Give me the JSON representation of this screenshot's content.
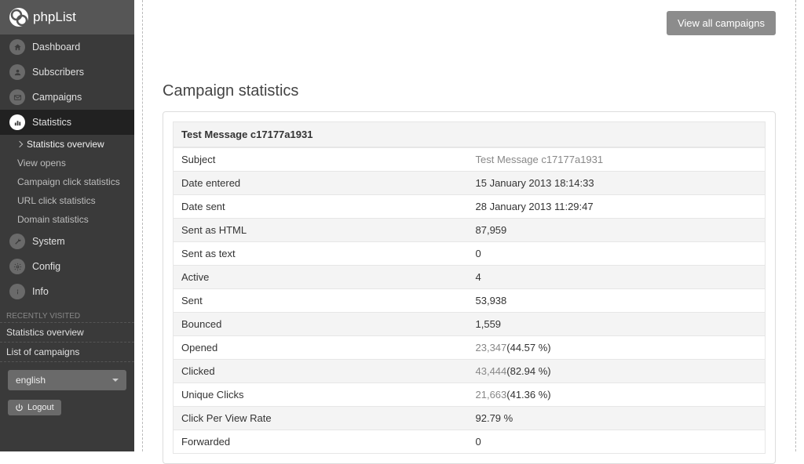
{
  "logo": {
    "text": "phpList"
  },
  "nav": {
    "dashboard": "Dashboard",
    "subscribers": "Subscribers",
    "campaigns": "Campaigns",
    "statistics": "Statistics",
    "system": "System",
    "config": "Config",
    "info": "Info"
  },
  "subnav": {
    "overview": "Statistics overview",
    "view_opens": "View opens",
    "campaign_clicks": "Campaign click statistics",
    "url_clicks": "URL click statistics",
    "domain": "Domain statistics"
  },
  "recent": {
    "header": "RECENTLY VISITED",
    "items": [
      "Statistics overview",
      "List of campaigns"
    ]
  },
  "lang": {
    "selected": "english"
  },
  "logout": "Logout",
  "buttons": {
    "view_all": "View all campaigns"
  },
  "page_title": "Campaign statistics",
  "campaign_name": "Test Message c17177a1931",
  "rows": {
    "subject": {
      "label": "Subject",
      "value": "Test Message c17177a1931",
      "link": true
    },
    "date_entered": {
      "label": "Date entered",
      "value": "15 January 2013 18:14:33"
    },
    "date_sent": {
      "label": "Date sent",
      "value": "28 January 2013 11:29:47"
    },
    "sent_html": {
      "label": "Sent as HTML",
      "value": "87,959"
    },
    "sent_text": {
      "label": "Sent as text",
      "value": "0"
    },
    "active": {
      "label": "Active",
      "value": "4"
    },
    "sent": {
      "label": "Sent",
      "value": "53,938"
    },
    "bounced": {
      "label": "Bounced",
      "value": "1,559"
    },
    "opened": {
      "label": "Opened",
      "count": "23,347",
      "pct": "(44.57 %)"
    },
    "clicked": {
      "label": "Clicked",
      "count": "43,444",
      "pct": "(82.94 %)"
    },
    "unique": {
      "label": "Unique Clicks",
      "count": "21,663",
      "pct": "(41.36 %)"
    },
    "cpvr": {
      "label": "Click Per View Rate",
      "value": "92.79 %"
    },
    "forwarded": {
      "label": "Forwarded",
      "value": "0"
    }
  }
}
